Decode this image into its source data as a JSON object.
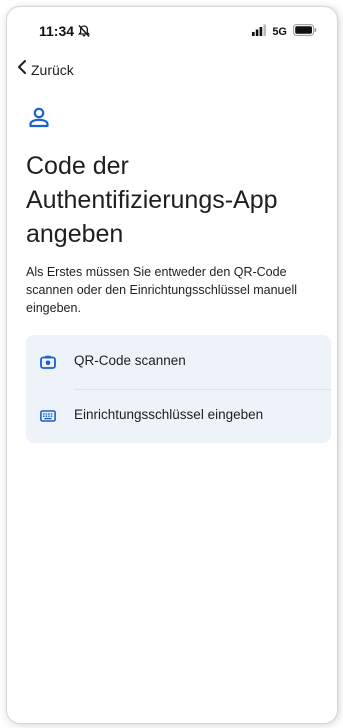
{
  "status_bar": {
    "time": "11:34",
    "network": "5G"
  },
  "nav": {
    "back_label": "Zurück"
  },
  "header": {
    "title": "Code der Authentifizierungs-App angeben"
  },
  "main": {
    "description": "Als Erstes müssen Sie entweder den QR-Code scannen oder den Einrichtungsschlüssel manuell eingeben.",
    "options": [
      {
        "label": "QR-Code scannen",
        "icon": "camera-icon"
      },
      {
        "label": "Einrichtungsschlüssel eingeben",
        "icon": "keyboard-icon"
      }
    ]
  },
  "colors": {
    "accent": "#1a5fd0",
    "card_background": "#eef3f9"
  }
}
